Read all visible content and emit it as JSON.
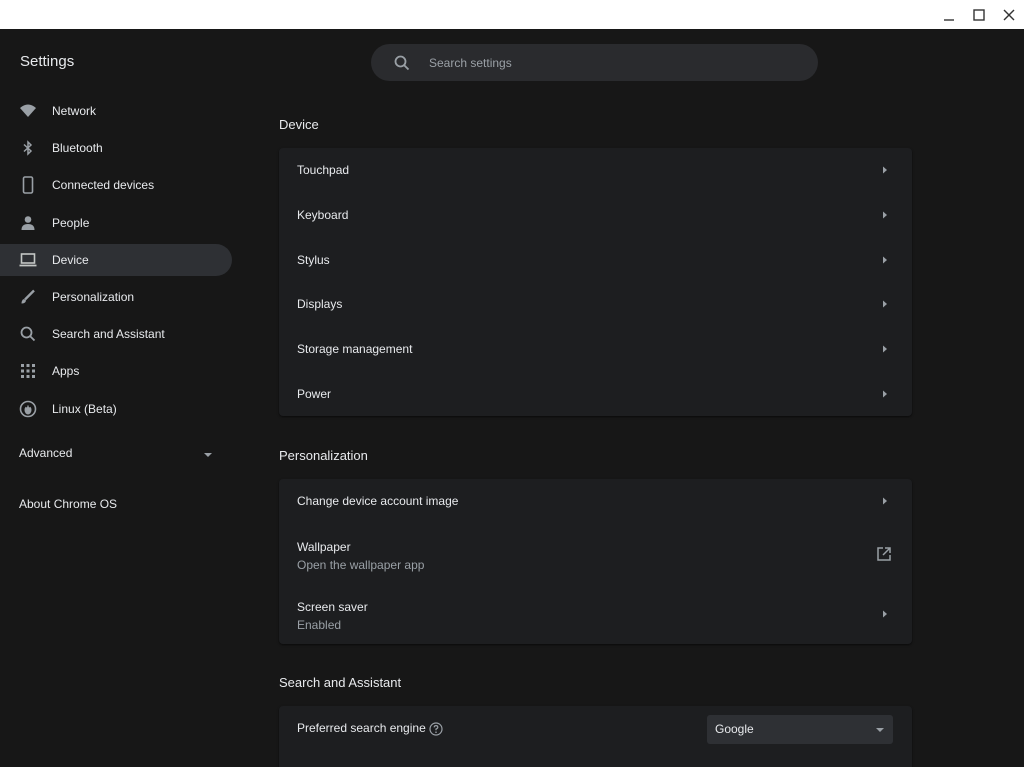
{
  "app": {
    "title": "Settings"
  },
  "search": {
    "placeholder": "Search settings"
  },
  "nav": {
    "items": [
      {
        "label": "Network",
        "icon": "wifi-icon"
      },
      {
        "label": "Bluetooth",
        "icon": "bluetooth-icon"
      },
      {
        "label": "Connected devices",
        "icon": "phone-icon"
      },
      {
        "label": "People",
        "icon": "person-icon"
      },
      {
        "label": "Device",
        "icon": "laptop-icon",
        "active": true
      },
      {
        "label": "Personalization",
        "icon": "brush-icon"
      },
      {
        "label": "Search and Assistant",
        "icon": "search-icon"
      },
      {
        "label": "Apps",
        "icon": "apps-grid-icon"
      },
      {
        "label": "Linux (Beta)",
        "icon": "penguin-icon"
      }
    ],
    "advanced_label": "Advanced",
    "about_label": "About Chrome OS"
  },
  "device": {
    "title": "Device",
    "rows": [
      "Touchpad",
      "Keyboard",
      "Stylus",
      "Displays",
      "Storage management",
      "Power"
    ]
  },
  "personalization": {
    "title": "Personalization",
    "account_image_label": "Change device account image",
    "wallpaper_label": "Wallpaper",
    "wallpaper_sub": "Open the wallpaper app",
    "screensaver_label": "Screen saver",
    "screensaver_sub": "Enabled"
  },
  "search_assistant": {
    "title": "Search and Assistant",
    "engine_label": "Preferred search engine",
    "engine_value": "Google"
  },
  "colors": {
    "background": "#171717",
    "card": "#1d1e20",
    "active_nav": "#2e3034",
    "text": "#e8eaed",
    "secondary_text": "#9aa0a6"
  }
}
